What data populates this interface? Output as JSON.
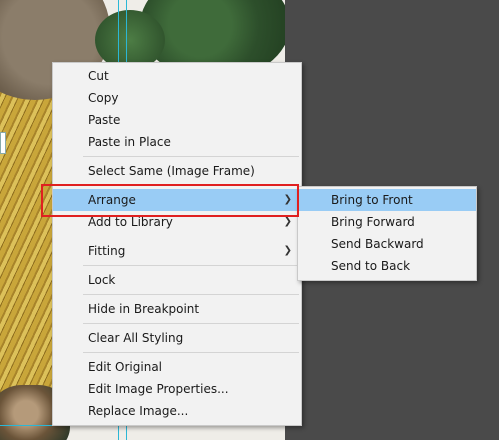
{
  "context_menu": {
    "groups": [
      [
        "Cut",
        "Copy",
        "Paste",
        "Paste in Place"
      ],
      [
        "Select Same (Image Frame)"
      ],
      [
        "Arrange",
        "Add to Library",
        "Fitting"
      ],
      [
        "Lock"
      ],
      [
        "Hide in Breakpoint"
      ],
      [
        "Clear All Styling"
      ],
      [
        "Edit Original",
        "Edit Image Properties...",
        "Replace Image..."
      ]
    ],
    "active_item": "Arrange"
  },
  "arrange_submenu": {
    "items": [
      "Bring to Front",
      "Bring Forward",
      "Send Backward",
      "Send to Back"
    ],
    "active_item": "Bring to Front"
  },
  "colors": {
    "menu_background": "#f2f2f2",
    "highlight": "#99ccf5",
    "annotation_border": "#e02020",
    "frame_guides": "#2bb7d6",
    "workspace": "#4a4a4a"
  }
}
